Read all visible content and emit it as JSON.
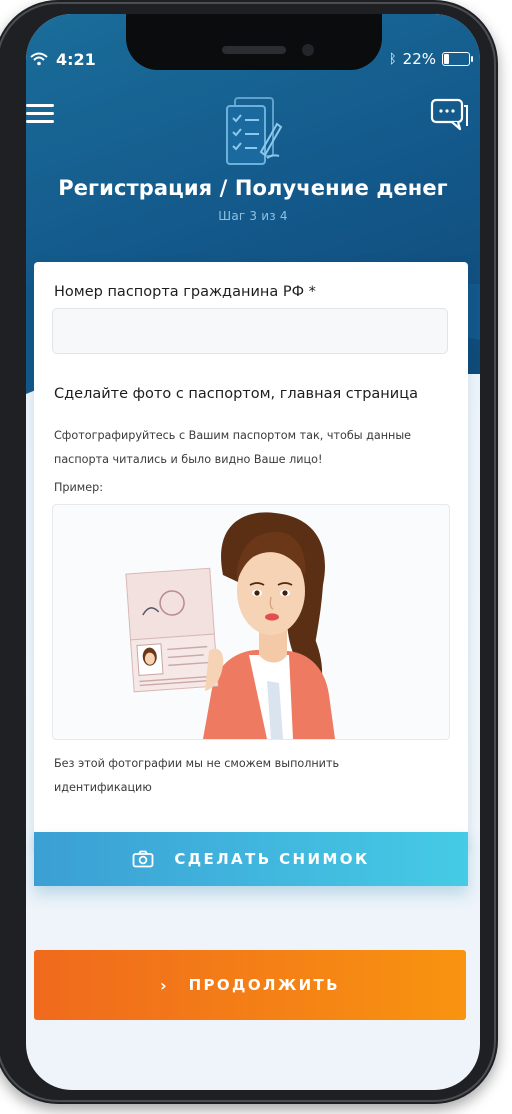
{
  "status_bar": {
    "time": "4:21",
    "battery_text": "22%",
    "battery_level": 0.22
  },
  "header": {
    "title": "Регистрация / Получение денег",
    "step": "Шаг 3 из 4",
    "menu_icon": "hamburger-menu-icon",
    "chat_icon": "chat-bubble-icon",
    "hero_icon": "form-document-icon"
  },
  "form": {
    "passport_label": "Номер паспорта гражданина РФ *",
    "passport_value": "",
    "photo_title": "Сделайте фото с паспортом, главная страница",
    "photo_instruction": "Сфотографируйтесь с Вашим паспортом так, чтобы данные паспорта читались и было видно Ваше лицо!",
    "example_label": "Пример:",
    "warning": "Без этой фотографии мы не сможем выполнить идентификацию"
  },
  "buttons": {
    "take_photo": "СДЕЛАТЬ СНИМОК",
    "continue": "ПРОДОЛЖИТЬ"
  },
  "colors": {
    "header": "#13588a",
    "photo_button": "#41b7de",
    "continue_button": "#f48016"
  }
}
